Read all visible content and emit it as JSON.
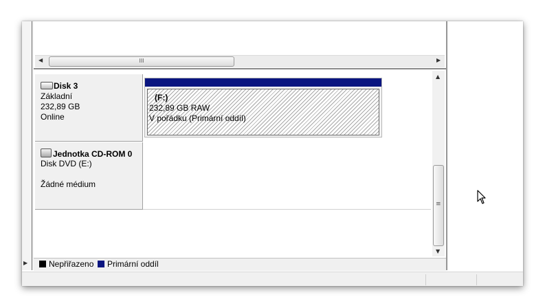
{
  "disks": [
    {
      "name": "Disk 3",
      "type": "Základní",
      "size": "232,89 GB",
      "status": "Online",
      "icon": "hard-disk-icon",
      "partition": {
        "label": "(F:)",
        "size_fs": "232,89 GB RAW",
        "status": "V pořádku (Primární oddíl)"
      }
    },
    {
      "name": "Jednotka CD-ROM 0",
      "type": "Disk DVD (E:)",
      "status": "Žádné médium",
      "icon": "cd-rom-icon"
    }
  ],
  "scrollbar": {
    "grip_h": "III",
    "grip_v": "≡"
  },
  "legend": [
    {
      "label": "Nepřiřazeno",
      "color": "#000000"
    },
    {
      "label": "Primární oddíl",
      "color": "#0a1580"
    }
  ]
}
